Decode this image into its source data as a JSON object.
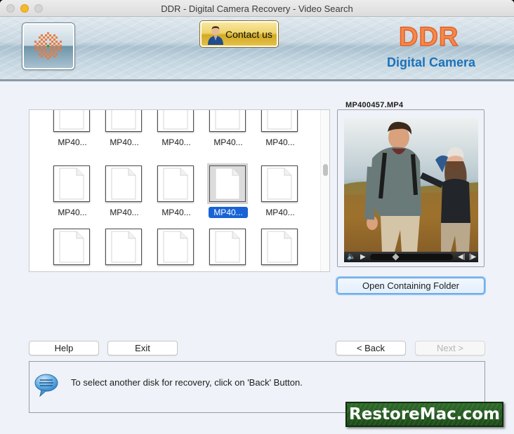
{
  "window": {
    "title": "DDR - Digital Camera Recovery - Video Search",
    "traffic_lights": [
      "close",
      "minimize",
      "zoom"
    ]
  },
  "header": {
    "logo_icon": "checker-star-logo-icon",
    "contact_button": "Contact us",
    "brand_title": "DDR",
    "brand_subtitle": "Digital Camera",
    "colors": {
      "brand_orange": "#f58a4a",
      "brand_blue": "#1b72b8",
      "contact_gold": "#e2c04a"
    }
  },
  "file_grid": {
    "rows": [
      [
        "MP40...",
        "MP40...",
        "MP40...",
        "MP40...",
        "MP40..."
      ],
      [
        "MP40...",
        "MP40...",
        "MP40...",
        "MP40...",
        "MP40..."
      ],
      [
        "",
        "",
        "",
        "",
        ""
      ]
    ],
    "selected": {
      "row": 1,
      "col": 3
    },
    "selection_color": "#1863d6"
  },
  "preview": {
    "filename": "MP400457.MP4",
    "image_description": "Two hikers with backpacks walking through golden grass by the sea",
    "controls": {
      "volume_icon": "speaker-icon",
      "play_icon": "play-icon",
      "seek_position": 0.3,
      "prev_icon": "step-back-icon",
      "next_icon": "step-forward-icon"
    },
    "open_folder_button": "Open Containing Folder"
  },
  "buttons": {
    "help": "Help",
    "exit": "Exit",
    "back": "< Back",
    "next": "Next >"
  },
  "info": {
    "icon": "speech-bubble-icon",
    "message": "To select another disk for recovery, click on 'Back' Button."
  },
  "watermark": "RestoreMac.com"
}
